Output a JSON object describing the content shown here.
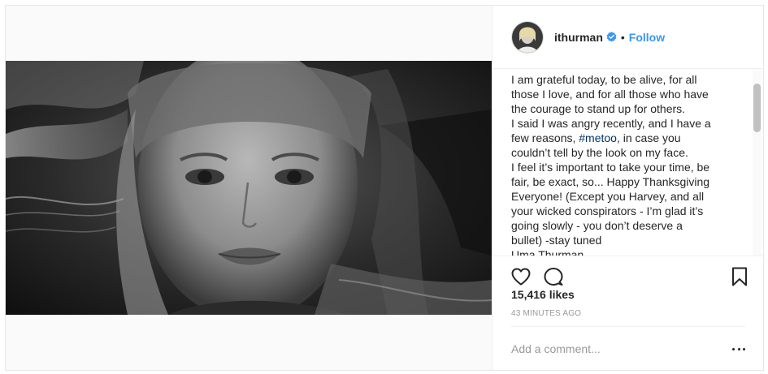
{
  "post": {
    "photo_icon": "portrait-photo",
    "author": {
      "username": "ithurman",
      "verified": true,
      "separator": "•",
      "follow_label": "Follow"
    },
    "caption": {
      "lines": [
        "I am grateful today, to be alive, for all",
        "those I love, and for all those who have",
        "the courage to stand up for others.",
        "I said I was angry recently, and I have a",
        "few reasons, ",
        "couldn’t tell by the look on my face.",
        "I feel it’s important to take your time, be",
        "fair, be exact, so... Happy Thanksgiving",
        "Everyone! (Except you Harvey, and all",
        "your wicked conspirators - I’m glad it’s",
        "going slowly - you don’t deserve a",
        "bullet) -stay tuned",
        "Uma Thurman"
      ],
      "hashtag": "#metoo",
      "hashtag_suffix": ", in case you"
    },
    "actions": {
      "like_icon": "heart-icon",
      "comment_icon": "comment-icon",
      "save_icon": "bookmark-icon"
    },
    "likes": "15,416 likes",
    "timestamp": "43 MINUTES AGO",
    "comment": {
      "placeholder": "Add a comment...",
      "more_icon": "more-options-icon"
    }
  },
  "colors": {
    "link": "#3897f0",
    "hashtag": "#003569",
    "text": "#262626",
    "muted": "#999999",
    "border": "#efefef"
  }
}
